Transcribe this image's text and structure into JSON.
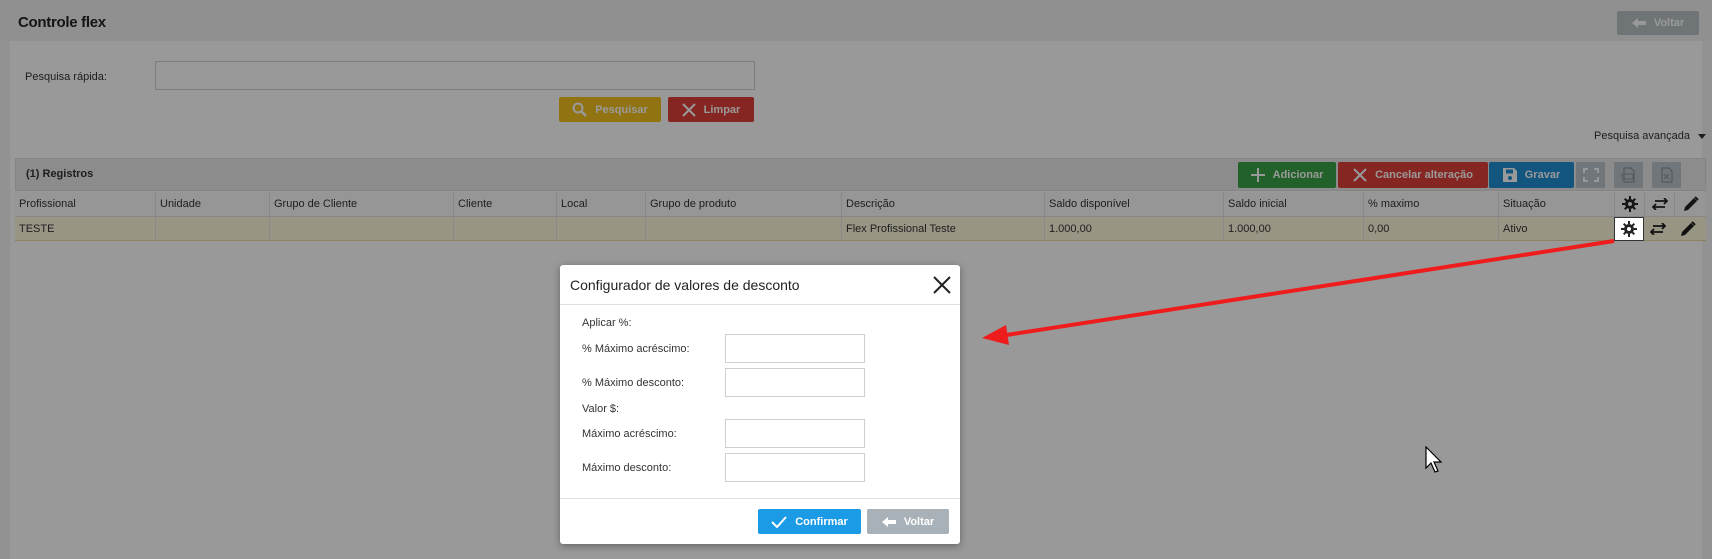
{
  "page": {
    "title": "Controle flex",
    "back_label": "Voltar"
  },
  "search": {
    "label": "Pesquisa rápida:",
    "value": "",
    "search_button": "Pesquisar",
    "clear_button": "Limpar",
    "advanced_label": "Pesquisa avançada"
  },
  "records": {
    "title": "(1) Registros",
    "add_button": "Adicionar",
    "cancel_button": "Cancelar alteração",
    "save_button": "Gravar",
    "icon_buttons": [
      "expand-icon",
      "export-pdf-icon",
      "export-excel-icon"
    ]
  },
  "table": {
    "columns": [
      "Profissional",
      "Unidade",
      "Grupo de Cliente",
      "Cliente",
      "Local",
      "Grupo de produto",
      "Descrição",
      "Saldo disponível",
      "Saldo inicial",
      "% maximo",
      "Situação"
    ],
    "header_icons": [
      "gear-icon",
      "swap-icon",
      "pencil-icon"
    ],
    "rows": [
      [
        "TESTE",
        "",
        "",
        "",
        "",
        "",
        "Flex Profissional Teste",
        "1.000,00",
        "1.000,00",
        "0,00",
        "Ativo"
      ]
    ]
  },
  "modal": {
    "title": "Configurador de valores de desconto",
    "section_percent": "Aplicar %:",
    "max_increase_pct_label": "% Máximo acréscimo:",
    "max_increase_pct_value": "",
    "max_discount_pct_label": "% Máximo desconto:",
    "max_discount_pct_value": "",
    "section_value": "Valor $:",
    "max_increase_label": "Máximo acréscimo:",
    "max_increase_value": "",
    "max_discount_label": "Máximo desconto:",
    "max_discount_value": "",
    "confirm_button": "Confirmar",
    "back_button": "Voltar"
  },
  "colors": {
    "yellow": "#f2c21d",
    "red": "#e0403a",
    "green": "#3aa346",
    "blue": "#1e8fd6",
    "confirm_blue": "#1b9be6",
    "gray": "#a8b1b8",
    "row_highlight": "#fff8de",
    "annotation_arrow": "#ee1c1c"
  }
}
